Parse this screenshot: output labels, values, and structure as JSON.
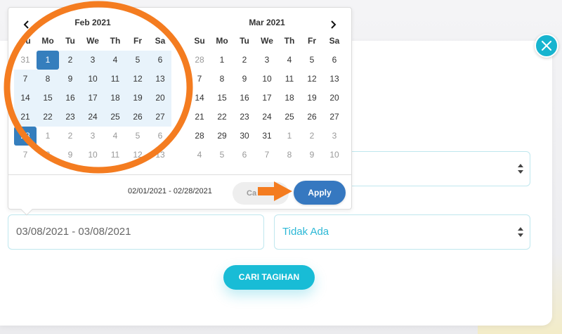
{
  "datepicker": {
    "left_month": {
      "title": "Feb 2021",
      "weekdays": [
        "Su",
        "Mo",
        "Tu",
        "We",
        "Th",
        "Fr",
        "Sa"
      ],
      "weeks": [
        [
          "31",
          "1",
          "2",
          "3",
          "4",
          "5",
          "6"
        ],
        [
          "7",
          "8",
          "9",
          "10",
          "11",
          "12",
          "13"
        ],
        [
          "14",
          "15",
          "16",
          "17",
          "18",
          "19",
          "20"
        ],
        [
          "21",
          "22",
          "23",
          "24",
          "25",
          "26",
          "27"
        ],
        [
          "28",
          "1",
          "2",
          "3",
          "4",
          "5",
          "6"
        ],
        [
          "7",
          "8",
          "9",
          "10",
          "11",
          "12",
          "13"
        ]
      ]
    },
    "right_month": {
      "title": "Mar 2021",
      "weekdays": [
        "Su",
        "Mo",
        "Tu",
        "We",
        "Th",
        "Fr",
        "Sa"
      ],
      "weeks": [
        [
          "28",
          "1",
          "2",
          "3",
          "4",
          "5",
          "6"
        ],
        [
          "7",
          "8",
          "9",
          "10",
          "11",
          "12",
          "13"
        ],
        [
          "14",
          "15",
          "16",
          "17",
          "18",
          "19",
          "20"
        ],
        [
          "21",
          "22",
          "23",
          "24",
          "25",
          "26",
          "27"
        ],
        [
          "28",
          "29",
          "30",
          "31",
          "1",
          "2",
          "3"
        ],
        [
          "4",
          "5",
          "6",
          "7",
          "8",
          "9",
          "10"
        ]
      ]
    },
    "range_text": "02/01/2021 - 02/28/2021",
    "cancel_label": "Ca",
    "apply_label": "Apply"
  },
  "form": {
    "date_range_value": "03/08/2021 - 03/08/2021",
    "status_value": "Tidak Ada",
    "search_button_label": "CARI TAGIHAN"
  },
  "icons": {
    "close": "close-icon",
    "prev": "chevron-left-icon",
    "next": "chevron-right-icon",
    "select": "updown-arrows-icon"
  },
  "colors": {
    "accent_teal": "#17b4cf",
    "range_active": "#357ebd",
    "range_bg": "#e8f3fb",
    "apply_blue": "#3678c0",
    "annotation_orange": "#f47c20"
  }
}
